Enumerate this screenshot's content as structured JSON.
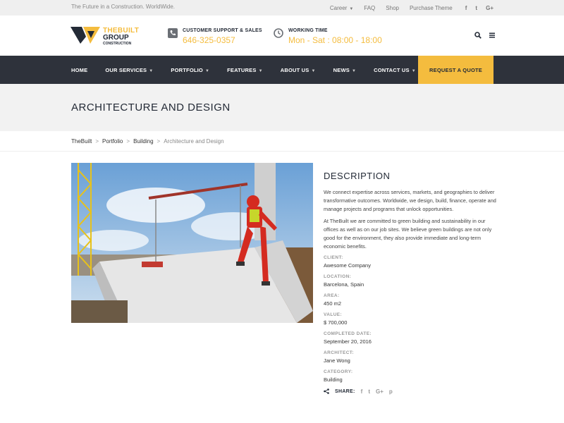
{
  "topbar": {
    "tagline": "The Future in a Construction. WorldWide.",
    "links": [
      "Career",
      "FAQ",
      "Shop",
      "Purchase Theme"
    ],
    "social": [
      "f",
      "t",
      "G+"
    ]
  },
  "brand": {
    "line1": "THEBUILT",
    "line2": "GROUP",
    "line3": "CONSTRUCTION"
  },
  "contact": {
    "support_label": "CUSTOMER SUPPORT & SALES",
    "support_value": "646-325-0357",
    "hours_label": "WORKING TIME",
    "hours_value": "Mon - Sat : 08:00 - 18:00"
  },
  "nav": {
    "items": [
      "HOME",
      "OUR SERVICES",
      "PORTFOLIO",
      "FEATURES",
      "ABOUT US",
      "NEWS",
      "CONTACT US"
    ],
    "cta": "REQUEST A QUOTE"
  },
  "page": {
    "title": "ARCHITECTURE AND DESIGN",
    "breadcrumb": [
      "TheBuilt",
      "Portfolio",
      "Building",
      "Architecture and Design"
    ]
  },
  "description": {
    "heading": "DESCRIPTION",
    "p1": "We connect expertise across services, markets, and geographies to deliver transformative outcomes. Worldwide, we design, build, finance, operate and manage projects and programs that unlock opportunities.",
    "p2": "At TheBuilt we are committed to green building and sustainability in our offices as well as on our job sites. We believe green buildings are not only good for the environment, they also provide immediate and long-term economic benefits."
  },
  "details": [
    {
      "label": "CLIENT:",
      "value": "Awesome Company"
    },
    {
      "label": "LOCATION:",
      "value": "Barcelona, Spain"
    },
    {
      "label": "AREA:",
      "value": "450 m2"
    },
    {
      "label": "VALUE:",
      "value": "$ 700,000"
    },
    {
      "label": "COMPLETED DATE:",
      "value": "September 20, 2016"
    },
    {
      "label": "ARCHITECT:",
      "value": "Jane Wong"
    },
    {
      "label": "CATEGORY:",
      "value": "Building"
    }
  ],
  "share": {
    "label": "SHARE:",
    "icons": [
      "f",
      "t",
      "G+",
      "p"
    ]
  },
  "colors": {
    "accent": "#f4bc3e",
    "nav_bg": "#2e323b",
    "title_bg": "#f2f2f2"
  }
}
